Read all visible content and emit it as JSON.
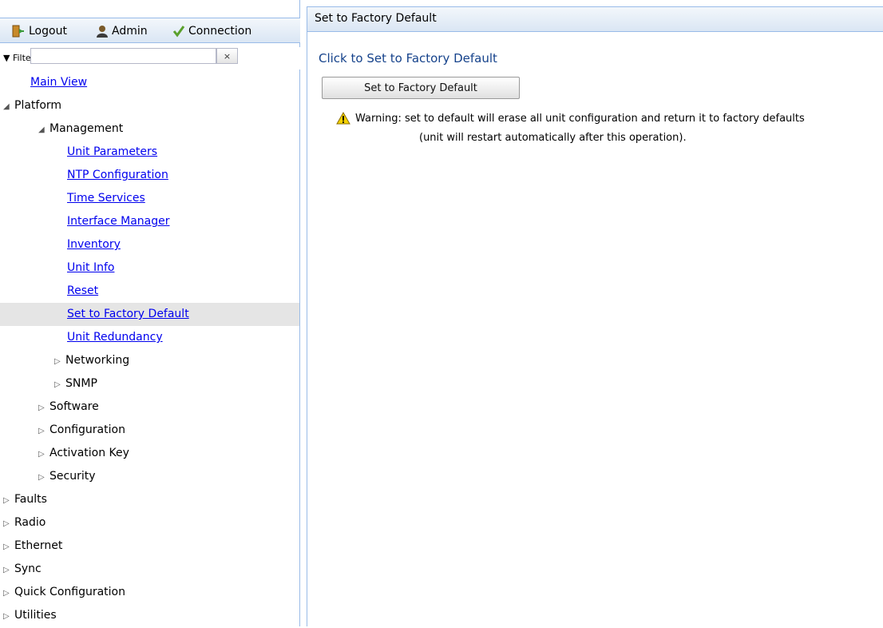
{
  "toolbar": {
    "logout_label": "Logout",
    "admin_label": "Admin",
    "connection_label": "Connection"
  },
  "filter": {
    "label": "▼ Filter",
    "value": "",
    "clear_label": "×"
  },
  "tree": {
    "items": [
      {
        "label": "Main View",
        "level": 0,
        "link": true
      },
      {
        "label": "Platform",
        "level": 0,
        "expanded": true
      },
      {
        "label": "Management",
        "level": 1,
        "expanded": true
      },
      {
        "label": "Unit Parameters",
        "level": 2,
        "link": true
      },
      {
        "label": "NTP Configuration",
        "level": 2,
        "link": true
      },
      {
        "label": "Time Services",
        "level": 2,
        "link": true
      },
      {
        "label": "Interface Manager",
        "level": 2,
        "link": true
      },
      {
        "label": "Inventory",
        "level": 2,
        "link": true
      },
      {
        "label": "Unit Info",
        "level": 2,
        "link": true
      },
      {
        "label": "Reset",
        "level": 2,
        "link": true
      },
      {
        "label": "Set to Factory Default",
        "level": 2,
        "link": true,
        "selected": true
      },
      {
        "label": "Unit Redundancy",
        "level": 2,
        "link": true
      },
      {
        "label": "Networking",
        "level": 1,
        "collapsed": true
      },
      {
        "label": "SNMP",
        "level": 1,
        "collapsed": true
      },
      {
        "label": "Software",
        "level": 0,
        "collapsed": true,
        "sub": true
      },
      {
        "label": "Configuration",
        "level": 0,
        "collapsed": true,
        "sub": true
      },
      {
        "label": "Activation Key",
        "level": 0,
        "collapsed": true,
        "sub": true
      },
      {
        "label": "Security",
        "level": 0,
        "collapsed": true,
        "sub": true
      },
      {
        "label": "Faults",
        "level": 0,
        "collapsed": true
      },
      {
        "label": "Radio",
        "level": 0,
        "collapsed": true
      },
      {
        "label": "Ethernet",
        "level": 0,
        "collapsed": true
      },
      {
        "label": "Sync",
        "level": 0,
        "collapsed": true
      },
      {
        "label": "Quick Configuration",
        "level": 0,
        "collapsed": true
      },
      {
        "label": "Utilities",
        "level": 0,
        "collapsed": true
      }
    ]
  },
  "main": {
    "title": "Set to Factory Default",
    "click_label": "Click to Set to Factory Default",
    "button_label": "Set to Factory Default",
    "warning_line1": "Warning: set to default will erase all unit configuration and return it to factory defaults",
    "warning_line2": "(unit will restart automatically after this operation)."
  }
}
